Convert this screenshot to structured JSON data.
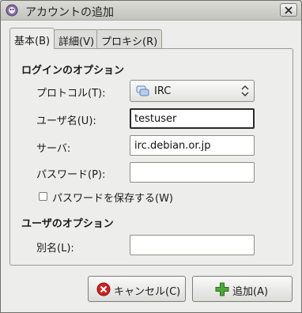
{
  "window": {
    "title": "アカウントの追加"
  },
  "tabs": [
    {
      "label": "基本(B)"
    },
    {
      "label": "詳細(V)"
    },
    {
      "label": "プロキシ(R)"
    }
  ],
  "login_options": {
    "heading": "ログインのオプション",
    "protocol_label": "プロトコル(T):",
    "protocol_value": "IRC",
    "username_label": "ユーザ名(U):",
    "username_value": "testuser",
    "server_label": "サーバ:",
    "server_value": "irc.debian.or.jp",
    "password_label": "パスワード(P):",
    "password_value": "",
    "remember_password_label": "パスワードを保存する(W)",
    "remember_password_checked": false
  },
  "user_options": {
    "heading": "ユーザのオプション",
    "alias_label": "別名(L):",
    "alias_value": ""
  },
  "buttons": {
    "cancel": "キャンセル(C)",
    "add": "追加(A)"
  },
  "colors": {
    "cancel_icon": "#cc2222",
    "add_icon": "#4fa83a"
  }
}
